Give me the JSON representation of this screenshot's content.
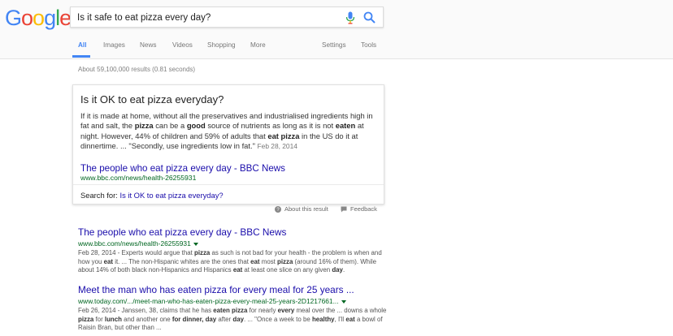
{
  "logo": {
    "letters": [
      "G",
      "o",
      "o",
      "g",
      "l",
      "e"
    ],
    "colors": [
      "#4285f4",
      "#ea4335",
      "#fbbc05",
      "#4285f4",
      "#34a853",
      "#ea4335"
    ]
  },
  "search": {
    "query": "Is it safe to eat pizza every day?"
  },
  "icons": {
    "mic": "microphone-icon",
    "search": "magnifier-icon"
  },
  "tabs": [
    "All",
    "Images",
    "News",
    "Videos",
    "Shopping",
    "More"
  ],
  "tools": [
    "Settings",
    "Tools"
  ],
  "stats": "About 59,100,000 results (0.81 seconds)",
  "featured": {
    "question": "Is it OK to eat pizza everyday?",
    "t1": "If it is made at home, without all the preservatives and industrialised ingredients high in fat and salt, the ",
    "b1": "pizza",
    "t2": " can be a ",
    "b2": "good",
    "t3": " source of nutrients as long as it is not ",
    "b3": "eaten",
    "t4": " at night. However, 44% of children and 59% of adults that ",
    "b4": "eat pizza",
    "t5": " in the US do it at dinnertime. ... \"Secondly, use ingredients low in fat.\"",
    "date": "Feb 28, 2014",
    "link": "The people who eat pizza every day - BBC News",
    "url": "www.bbc.com/news/health-26255931",
    "search_label": "Search for:",
    "search_link": "Is it OK to eat pizza everyday?"
  },
  "about_label": "About this result",
  "feedback_label": "Feedback",
  "results": [
    {
      "title": "The people who eat pizza every day - BBC News",
      "url": "www.bbc.com/news/health-26255931",
      "s1": "Feb 28, 2014 - Experts would argue that ",
      "s2": "pizza",
      "s3": " as such is not bad for your health - the problem is when and how you ",
      "s4": "eat",
      "s5": " it. ... The non-Hispanic whites are the ones that ",
      "s6": "eat",
      "s7": " most ",
      "s8": "pizza",
      "s9": " (around 16% of them). While about 14% of both black non-Hispanics and Hispanics ",
      "s10": "eat",
      "s11": " at least one slice on any given ",
      "s12": "day",
      "s13": "."
    },
    {
      "title": "Meet the man who has eaten pizza for every meal for 25 years ...",
      "url": "www.today.com/.../meet-man-who-has-eaten-pizza-every-meal-25-years-2D1217661...",
      "s1": "Feb 26, 2014 - Janssen, 38, claims that he has ",
      "s2": "eaten pizza",
      "s3": " for nearly ",
      "s4": "every",
      "s5": " meal over the ... downs a whole ",
      "s6": "pizza",
      "s7": " for ",
      "s8": "lunch",
      "s9": " and another one ",
      "s10": "for dinner, day",
      "s11": " after ",
      "s12": "day",
      "s13": ". ... \"Once a week to be ",
      "s14": "healthy",
      "s15": ", I'll ",
      "s16": "eat",
      "s17": " a bowl of Raisin Bran, but other than ..."
    }
  ]
}
